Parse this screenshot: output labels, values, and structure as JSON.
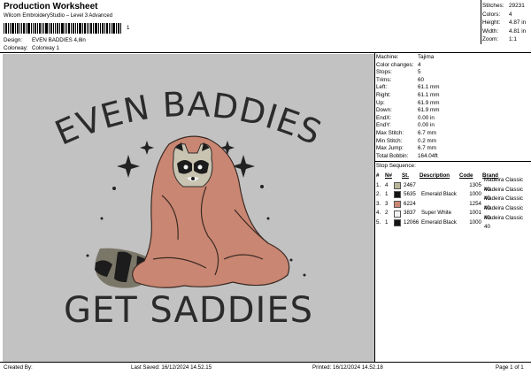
{
  "header": {
    "title": "Production Worksheet",
    "subtitle": "Wilcom EmbroideryStudio – Level 3 Advanced",
    "barcode_suffix": "1",
    "design_label": "Design:",
    "design_value": "EVEN BADDIES 4,8in",
    "colorway_label": "Colorway:",
    "colorway_value": "Colorway 1"
  },
  "stats": [
    {
      "label": "Stitches:",
      "value": "29231"
    },
    {
      "label": "Colors:",
      "value": "4"
    },
    {
      "label": "Height:",
      "value": "4.87 in"
    },
    {
      "label": "Width:",
      "value": "4.81 in"
    },
    {
      "label": "Zoom:",
      "value": "1:1"
    }
  ],
  "artwork": {
    "top_text": "EVEN BADDIES",
    "bottom_text": "GET SADDIES",
    "text_color": "#2b2b2b",
    "blanket_color": "#c98672",
    "background": "#c2c2c2"
  },
  "machine_info": [
    {
      "label": "Machine:",
      "value": "Tajima"
    },
    {
      "label": "Color changes:",
      "value": "4"
    },
    {
      "label": "Stops:",
      "value": "5"
    },
    {
      "label": "Trims:",
      "value": "60"
    },
    {
      "label": "Left:",
      "value": "61.1 mm"
    },
    {
      "label": "Right:",
      "value": "61.1 mm"
    },
    {
      "label": "Up:",
      "value": "61.9 mm"
    },
    {
      "label": "Down:",
      "value": "61.9 mm"
    },
    {
      "label": "EndX:",
      "value": "0.00 in"
    },
    {
      "label": "EndY:",
      "value": "0.00 in"
    },
    {
      "label": "Max Stitch:",
      "value": "6.7 mm"
    },
    {
      "label": "Min Stitch:",
      "value": "0.2 mm"
    },
    {
      "label": "Max Jump:",
      "value": "6.7 mm"
    },
    {
      "label": "Total Bobbin:",
      "value": "164.04ft"
    }
  ],
  "stop_sequence": {
    "title": "Stop Sequence:",
    "columns": [
      "#",
      "N#",
      "St.",
      "Description",
      "Code",
      "Brand"
    ],
    "rows": [
      {
        "num": "1.",
        "n": "4",
        "swatch": "#b9b59a",
        "st": "2467",
        "desc": "",
        "code": "1305",
        "brand": "Madeira Classic 40"
      },
      {
        "num": "2.",
        "n": "1",
        "swatch": "#141414",
        "st": "5635",
        "desc": "Emerald Black",
        "code": "1000",
        "brand": "Madeira Classic 40"
      },
      {
        "num": "3.",
        "n": "3",
        "swatch": "#c98672",
        "st": "6224",
        "desc": "",
        "code": "1254",
        "brand": "Madeira Classic 40"
      },
      {
        "num": "4.",
        "n": "2",
        "swatch": "#f2f2f2",
        "st": "3837",
        "desc": "Super White",
        "code": "1001",
        "brand": "Madeira Classic 40"
      },
      {
        "num": "5.",
        "n": "1",
        "swatch": "#141414",
        "st": "12066",
        "desc": "Emerald Black",
        "code": "1000",
        "brand": "Madeira Classic 40"
      }
    ]
  },
  "footer": {
    "created_by": "Created By:",
    "last_saved": "Last Saved: 16/12/2024 14.52.15",
    "printed": "Printed: 16/12/2024 14.52.18",
    "page": "Page 1 of 1"
  }
}
